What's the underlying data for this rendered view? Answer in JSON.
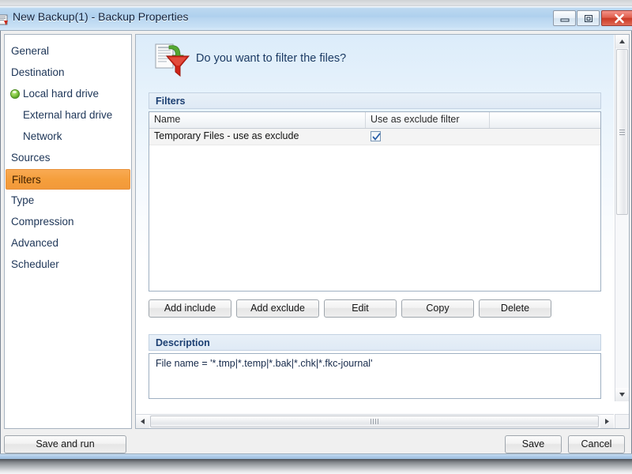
{
  "window": {
    "title": "New Backup(1) - Backup Properties",
    "app_icon": "backup-app-icon",
    "controls": {
      "minimize": "minimize-icon",
      "maximize": "maximize-icon",
      "close": "close-icon"
    }
  },
  "sidebar": {
    "items": [
      {
        "label": "General",
        "level": 0,
        "selected": false,
        "icon": null
      },
      {
        "label": "Destination",
        "level": 0,
        "selected": false,
        "icon": null
      },
      {
        "label": "Local hard drive",
        "level": 1,
        "selected": false,
        "icon": "green-bullet-icon"
      },
      {
        "label": "External hard drive",
        "level": 1,
        "selected": false,
        "icon": null
      },
      {
        "label": "Network",
        "level": 1,
        "selected": false,
        "icon": null
      },
      {
        "label": "Sources",
        "level": 0,
        "selected": false,
        "icon": null
      },
      {
        "label": "Filters",
        "level": 0,
        "selected": true,
        "icon": null
      },
      {
        "label": "Type",
        "level": 0,
        "selected": false,
        "icon": null
      },
      {
        "label": "Compression",
        "level": 0,
        "selected": false,
        "icon": null
      },
      {
        "label": "Advanced",
        "level": 0,
        "selected": false,
        "icon": null
      },
      {
        "label": "Scheduler",
        "level": 0,
        "selected": false,
        "icon": null
      }
    ]
  },
  "content": {
    "question": "Do you want to filter the files?",
    "question_icon": "document-filter-funnel-icon",
    "filters_section": {
      "title": "Filters",
      "columns": [
        "Name",
        "Use as exclude filter",
        ""
      ],
      "rows": [
        {
          "name": "Temporary Files - use as exclude",
          "use_as_exclude": true
        }
      ]
    },
    "buttons": {
      "add_include": "Add include",
      "add_exclude": "Add exclude",
      "edit": "Edit",
      "copy": "Copy",
      "delete": "Delete"
    },
    "description_section": {
      "title": "Description",
      "text": "File name = '*.tmp|*.temp|*.bak|*.chk|*.fkc-journal'"
    },
    "scrollbars": {
      "vertical": {
        "up": "scroll-up-icon",
        "down": "scroll-down-icon"
      },
      "horizontal": {
        "left": "scroll-left-icon",
        "right": "scroll-right-icon"
      }
    }
  },
  "footer": {
    "save_and_run": "Save and run",
    "save": "Save",
    "cancel": "Cancel"
  },
  "colors": {
    "selected_nav": "#F59F3C",
    "titlebar": "#AED0EE",
    "close_button": "#CB3A26",
    "section_text": "#1C3F72"
  }
}
